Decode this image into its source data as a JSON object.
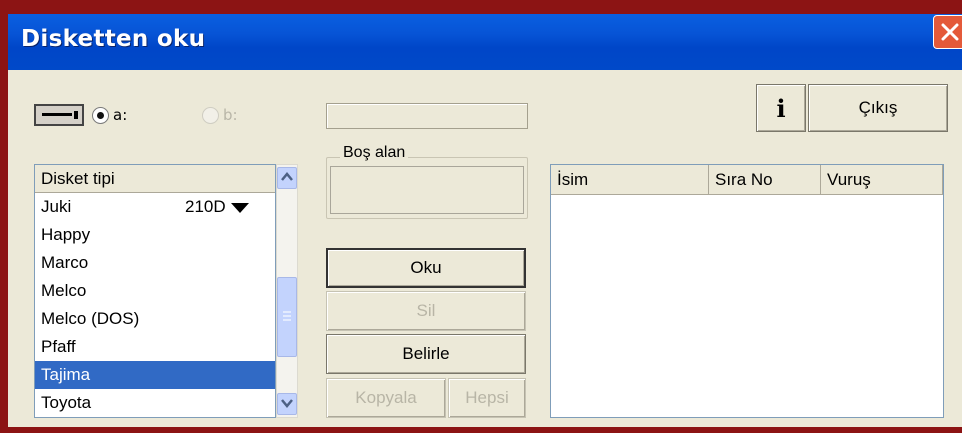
{
  "window": {
    "title": "Disketten  oku"
  },
  "drive": {
    "icon": "floppy-drive-icon",
    "options": [
      {
        "label": "a:",
        "checked": true,
        "enabled": true
      },
      {
        "label": "b:",
        "checked": false,
        "enabled": false
      }
    ],
    "path_value": ""
  },
  "info_button": {
    "label": "i"
  },
  "exit_button": {
    "label": "Çıkış"
  },
  "free_space": {
    "label": "Boş alan",
    "value": ""
  },
  "disk_type_list": {
    "header": "Disket tipi",
    "items": [
      {
        "label": "Juki",
        "extra": "210D"
      },
      {
        "label": "Happy"
      },
      {
        "label": "Marco"
      },
      {
        "label": "Melco"
      },
      {
        "label": "Melco (DOS)"
      },
      {
        "label": "Pfaff"
      },
      {
        "label": "Tajima",
        "selected": true
      },
      {
        "label": "Toyota"
      }
    ]
  },
  "buttons": {
    "read": "Oku",
    "delete": "Sil",
    "define": "Belirle",
    "copy": "Kopyala",
    "all": "Hepsi"
  },
  "file_list": {
    "columns": [
      "İsim",
      "Sıra No",
      "Vuruş"
    ],
    "rows": []
  },
  "colors": {
    "titlebar": "#0052d0",
    "selection": "#316ac5",
    "frame": "#8c1414"
  }
}
